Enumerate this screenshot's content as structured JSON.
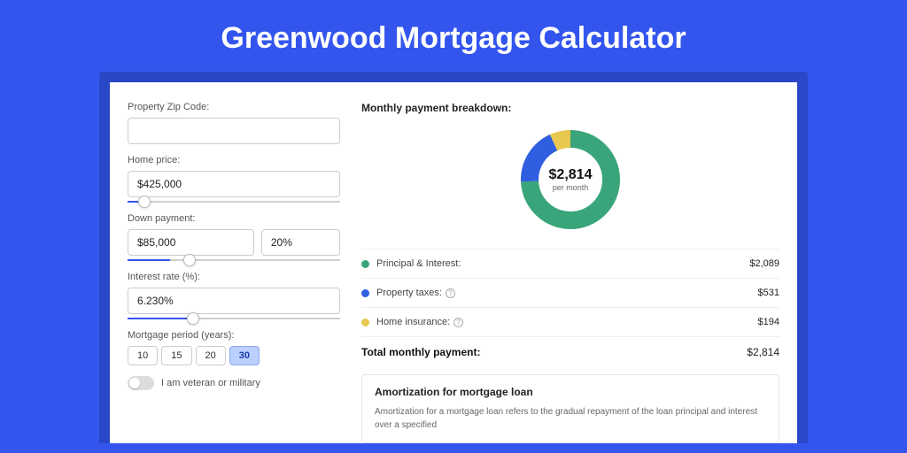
{
  "title": "Greenwood Mortgage Calculator",
  "form": {
    "zip_label": "Property Zip Code:",
    "zip_value": "",
    "home_price_label": "Home price:",
    "home_price_value": "$425,000",
    "home_price_slider_pct": 8,
    "down_payment_label": "Down payment:",
    "down_payment_value": "$85,000",
    "down_payment_pct_value": "20%",
    "down_payment_slider_pct": 20,
    "interest_label": "Interest rate (%):",
    "interest_value": "6.230%",
    "interest_slider_pct": 31,
    "period_label": "Mortgage period (years):",
    "periods": [
      "10",
      "15",
      "20",
      "30"
    ],
    "period_selected": "30",
    "veteran_label": "I am veteran or military"
  },
  "breakdown": {
    "title": "Monthly payment breakdown:",
    "total_value": "$2,814",
    "total_sub": "per month",
    "items": [
      {
        "label": "Principal & Interest:",
        "amount": "$2,089",
        "color": "#3aa57a",
        "info": false,
        "pct": 74.2
      },
      {
        "label": "Property taxes:",
        "amount": "$531",
        "color": "#2f5fe0",
        "info": true,
        "pct": 18.9
      },
      {
        "label": "Home insurance:",
        "amount": "$194",
        "color": "#e8c84e",
        "info": true,
        "pct": 6.9
      }
    ],
    "total_label": "Total monthly payment:",
    "total_amount": "$2,814"
  },
  "amortization": {
    "title": "Amortization for mortgage loan",
    "text": "Amortization for a mortgage loan refers to the gradual repayment of the loan principal and interest over a specified"
  },
  "chart_data": {
    "type": "pie",
    "title": "Monthly payment breakdown",
    "series": [
      {
        "name": "Principal & Interest",
        "value": 2089,
        "color": "#3aa57a"
      },
      {
        "name": "Property taxes",
        "value": 531,
        "color": "#2f5fe0"
      },
      {
        "name": "Home insurance",
        "value": 194,
        "color": "#e8c84e"
      }
    ],
    "total": 2814,
    "center_label": "$2,814 per month"
  }
}
